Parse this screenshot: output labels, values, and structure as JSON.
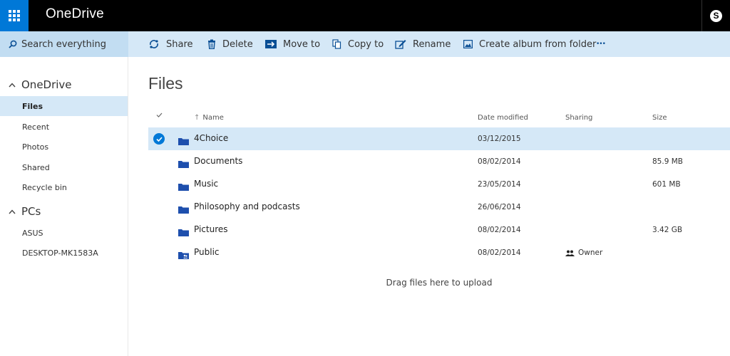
{
  "app": {
    "title": "OneDrive"
  },
  "search": {
    "label": "Search everything"
  },
  "commands": {
    "share": "Share",
    "delete": "Delete",
    "move_to": "Move to",
    "copy_to": "Copy to",
    "rename": "Rename",
    "create_album": "Create album from folder",
    "more": "•••"
  },
  "nav": {
    "onedrive_group": "OneDrive",
    "items": [
      "Files",
      "Recent",
      "Photos",
      "Shared",
      "Recycle bin"
    ],
    "pcs_group": "PCs",
    "pcs": [
      "ASUS",
      "DESKTOP-MK1583A"
    ]
  },
  "main": {
    "title": "Files",
    "columns": {
      "name": "Name",
      "date": "Date modified",
      "sharing": "Sharing",
      "size": "Size"
    },
    "rows": [
      {
        "name": "4Choice",
        "date": "03/12/2015",
        "sharing": "",
        "size": "",
        "selected": true,
        "shared_folder": false
      },
      {
        "name": "Documents",
        "date": "08/02/2014",
        "sharing": "",
        "size": "85.9 MB",
        "selected": false,
        "shared_folder": false
      },
      {
        "name": "Music",
        "date": "23/05/2014",
        "sharing": "",
        "size": "601 MB",
        "selected": false,
        "shared_folder": false
      },
      {
        "name": "Philosophy and podcasts",
        "date": "26/06/2014",
        "sharing": "",
        "size": "",
        "selected": false,
        "shared_folder": false
      },
      {
        "name": "Pictures",
        "date": "08/02/2014",
        "sharing": "",
        "size": "3.42 GB",
        "selected": false,
        "shared_folder": false
      },
      {
        "name": "Public",
        "date": "08/02/2014",
        "sharing": "Owner",
        "size": "",
        "selected": false,
        "shared_folder": true
      }
    ],
    "drop_hint": "Drag files here to upload"
  },
  "colors": {
    "accent": "#0078d7",
    "command_bar": "#d5e8f7",
    "selected": "#d5e8f7",
    "folder": "#1e4fad"
  }
}
